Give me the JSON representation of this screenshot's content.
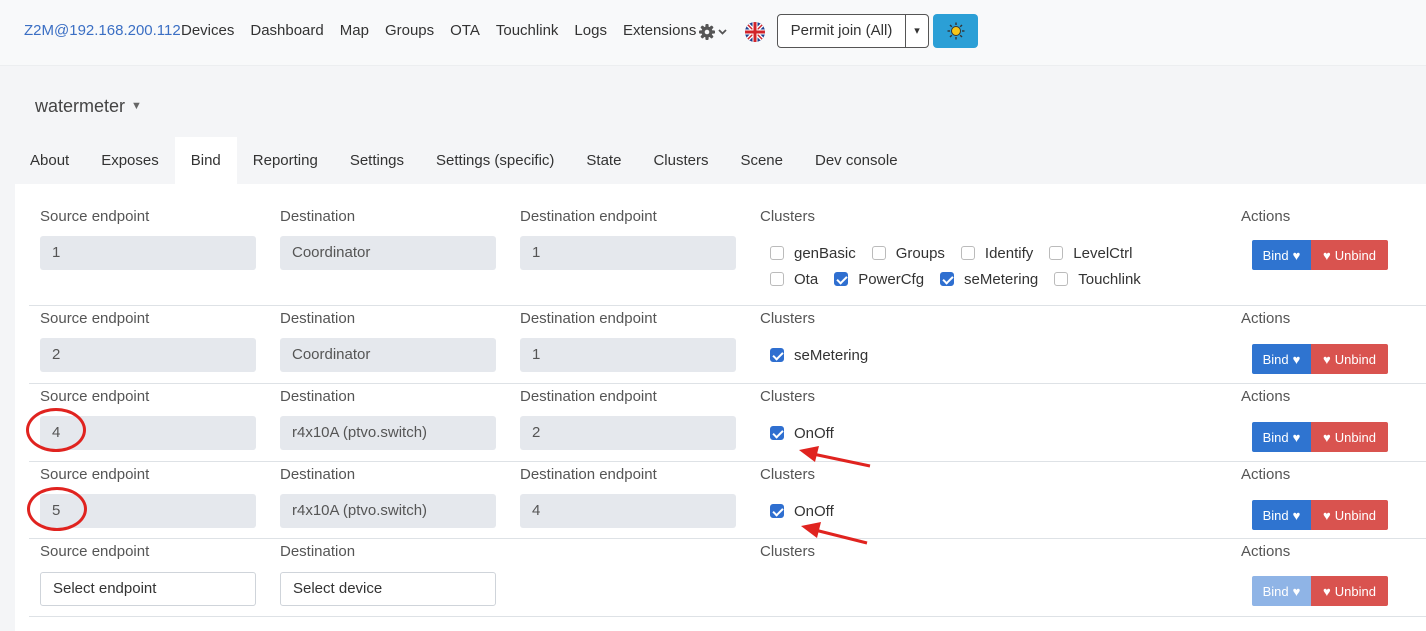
{
  "navbar": {
    "brand": "Z2M@192.168.200.112",
    "links": [
      "Devices",
      "Dashboard",
      "Map",
      "Groups",
      "OTA",
      "Touchlink",
      "Logs",
      "Extensions"
    ],
    "gear_icon": "gear-icon",
    "flag_icon": "uk-flag-icon",
    "permit_join_label": "Permit join (All)",
    "sun_icon": "sun-icon"
  },
  "device": {
    "name": "watermeter"
  },
  "tabs": [
    "About",
    "Exposes",
    "Bind",
    "Reporting",
    "Settings",
    "Settings (specific)",
    "State",
    "Clusters",
    "Scene",
    "Dev console"
  ],
  "active_tab": "Bind",
  "labels": {
    "source_endpoint": "Source endpoint",
    "destination": "Destination",
    "destination_endpoint": "Destination endpoint",
    "clusters": "Clusters",
    "actions": "Actions"
  },
  "buttons": {
    "bind": "Bind",
    "unbind": "Unbind"
  },
  "rows": [
    {
      "source": "1",
      "destination": "Coordinator",
      "dest_endpoint": "1",
      "clusters": [
        {
          "name": "genBasic",
          "checked": false
        },
        {
          "name": "Groups",
          "checked": false
        },
        {
          "name": "Identify",
          "checked": false
        },
        {
          "name": "LevelCtrl",
          "checked": false
        },
        {
          "name": "Ota",
          "checked": false
        },
        {
          "name": "PowerCfg",
          "checked": true
        },
        {
          "name": "seMetering",
          "checked": true
        },
        {
          "name": "Touchlink",
          "checked": false
        }
      ]
    },
    {
      "source": "2",
      "destination": "Coordinator",
      "dest_endpoint": "1",
      "clusters": [
        {
          "name": "seMetering",
          "checked": true
        }
      ]
    },
    {
      "source": "4",
      "destination": "r4x10A (ptvo.switch)",
      "dest_endpoint": "2",
      "clusters": [
        {
          "name": "OnOff",
          "checked": true
        }
      ]
    },
    {
      "source": "5",
      "destination": "r4x10A (ptvo.switch)",
      "dest_endpoint": "4",
      "clusters": [
        {
          "name": "OnOff",
          "checked": true
        }
      ]
    }
  ],
  "new_row": {
    "source_placeholder": "Select endpoint",
    "destination_placeholder": "Select device"
  },
  "colors": {
    "primary": "#2f74d0",
    "danger": "#d9534f",
    "annotation": "#e0231f"
  }
}
